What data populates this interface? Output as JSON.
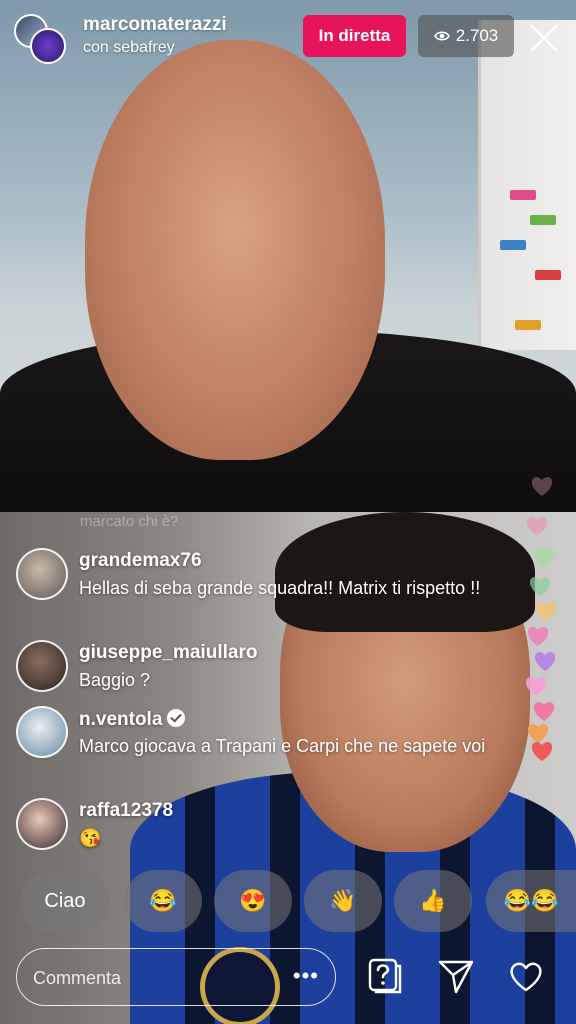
{
  "header": {
    "host_username": "marcomaterazzi",
    "guest_line": "con sebafrey",
    "live_label": "In diretta",
    "viewer_count": "2.703",
    "eye_icon": "eye-icon",
    "close_icon": "close-icon"
  },
  "faded_comment": "marcato chi è?",
  "comments": [
    {
      "user": "grandemax76",
      "text": "Hellas di seba grande squadra!! Matrix ti rispetto !!"
    },
    {
      "user": "giuseppe_maiullaro",
      "text": "Baggio ?"
    },
    {
      "user": "n.ventola",
      "text": "Marco giocava a Trapani e Carpi che ne sapete voi",
      "verified": true
    },
    {
      "user": "raffa12378",
      "text": "😘"
    }
  ],
  "quick_replies": [
    "Ciao",
    "😂",
    "😍",
    "👋",
    "👍",
    "😂😂"
  ],
  "composer": {
    "placeholder": "Commenta",
    "more_label": "•••",
    "question_icon": "question-icon",
    "send_icon": "send-icon",
    "like_icon": "heart-icon"
  },
  "colors": {
    "live_badge": "#e8145b",
    "viewer_badge": "#505050",
    "text": "#ffffff"
  }
}
